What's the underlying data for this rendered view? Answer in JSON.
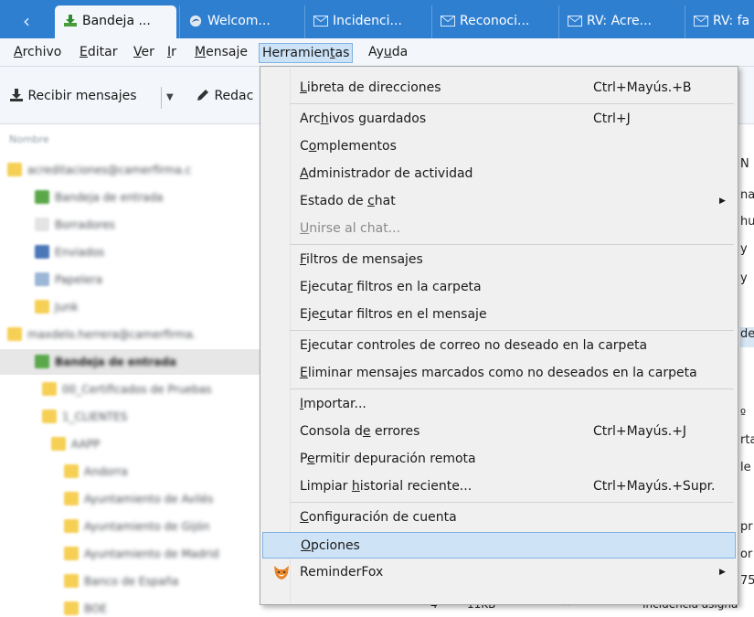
{
  "tabs": [
    {
      "label": "Bandeja ...",
      "icon": "inbox-download-icon",
      "active": true
    },
    {
      "label": "Welcom...",
      "icon": "thunderbird-icon"
    },
    {
      "label": "Incidenci...",
      "icon": "envelope-icon"
    },
    {
      "label": "Reconoci...",
      "icon": "envelope-icon"
    },
    {
      "label": "RV: Acre...",
      "icon": "envelope-icon"
    },
    {
      "label": "RV: fa",
      "icon": "envelope-icon"
    }
  ],
  "menubar": [
    {
      "label": "Archivo",
      "u": "A"
    },
    {
      "label": "Editar",
      "u": "E"
    },
    {
      "label": "Ver",
      "u": "V"
    },
    {
      "label": "Ir",
      "u": "I"
    },
    {
      "label": "Mensaje",
      "u": "M"
    },
    {
      "label": "Herramientas",
      "u": "t",
      "open": true
    },
    {
      "label": "Ayuda",
      "u": "u"
    }
  ],
  "toolbar": {
    "get_mail": "Recibir mensajes",
    "write": "Redac"
  },
  "folders": {
    "header": "Nombre",
    "items": [
      "acreditaciones@camerfirma.c",
      "Bandeja de entrada",
      "Borradores",
      "Enviados",
      "Papelera",
      "Junk",
      "maxdelo.herrera@camerfirma.",
      "Bandeja de entrada",
      "00_Certificados de Pruebas",
      "1_CLIENTES",
      "AAPP",
      "Andorra",
      "Ayuntamiento de Avilés",
      "Ayuntamiento de Gijón",
      "Ayuntamiento de Madrid",
      "Banco de España",
      "BOE"
    ]
  },
  "peek_text": [
    "N",
    "na",
    "hu",
    "y",
    "y",
    "de",
    "º",
    "rta",
    "le",
    "pr",
    "or",
    "75"
  ],
  "bottom_row": {
    "count": "4",
    "size": "11KB",
    "subject": "Incidencia asigna"
  },
  "dropdown": {
    "items": [
      {
        "label": "Libreta de direcciones",
        "u": "L",
        "shortcut": "Ctrl+Mayús.+B"
      },
      {
        "sep": true
      },
      {
        "label": "Archivos guardados",
        "u": "h",
        "shortcut": "Ctrl+J"
      },
      {
        "label": "Complementos",
        "u": "o"
      },
      {
        "label": "Administrador de actividad",
        "u": "A"
      },
      {
        "label": "Estado de chat",
        "u": "c",
        "submenu": true
      },
      {
        "label": "Unirse al chat...",
        "u": "U",
        "disabled": true
      },
      {
        "sep": true
      },
      {
        "label": "Filtros de mensajes",
        "u": "F"
      },
      {
        "label": "Ejecutar filtros en la carpeta",
        "u": "r"
      },
      {
        "label": "Ejecutar filtros en el mensaje",
        "u": "c"
      },
      {
        "sep": true
      },
      {
        "label": "Ejecutar controles de correo no deseado en la carpeta",
        "u": "j"
      },
      {
        "label": "Eliminar mensajes marcados como no deseados en la carpeta",
        "u": "E"
      },
      {
        "sep": true
      },
      {
        "label": "Importar...",
        "u": "I"
      },
      {
        "label": "Consola de errores",
        "u": "e",
        "shortcut": "Ctrl+Mayús.+J"
      },
      {
        "label": "Permitir depuración remota",
        "u": "e"
      },
      {
        "label": "Limpiar historial reciente...",
        "u": "h",
        "shortcut": "Ctrl+Mayús.+Supr."
      },
      {
        "sep": true
      },
      {
        "label": "Configuración de cuenta",
        "u": "C"
      },
      {
        "label": "Opciones",
        "u": "O",
        "highlighted": true
      },
      {
        "label": "ReminderFox",
        "icon": "fox-icon",
        "submenu": true
      }
    ]
  },
  "colors": {
    "tabbar": "#2f7fd1",
    "chrome": "#f3f6fa",
    "menu_bg": "#f0f0f0",
    "highlight": "#cfe3f7",
    "highlight_border": "#7fb1e2",
    "folder_yellow": "#f6cf55"
  }
}
